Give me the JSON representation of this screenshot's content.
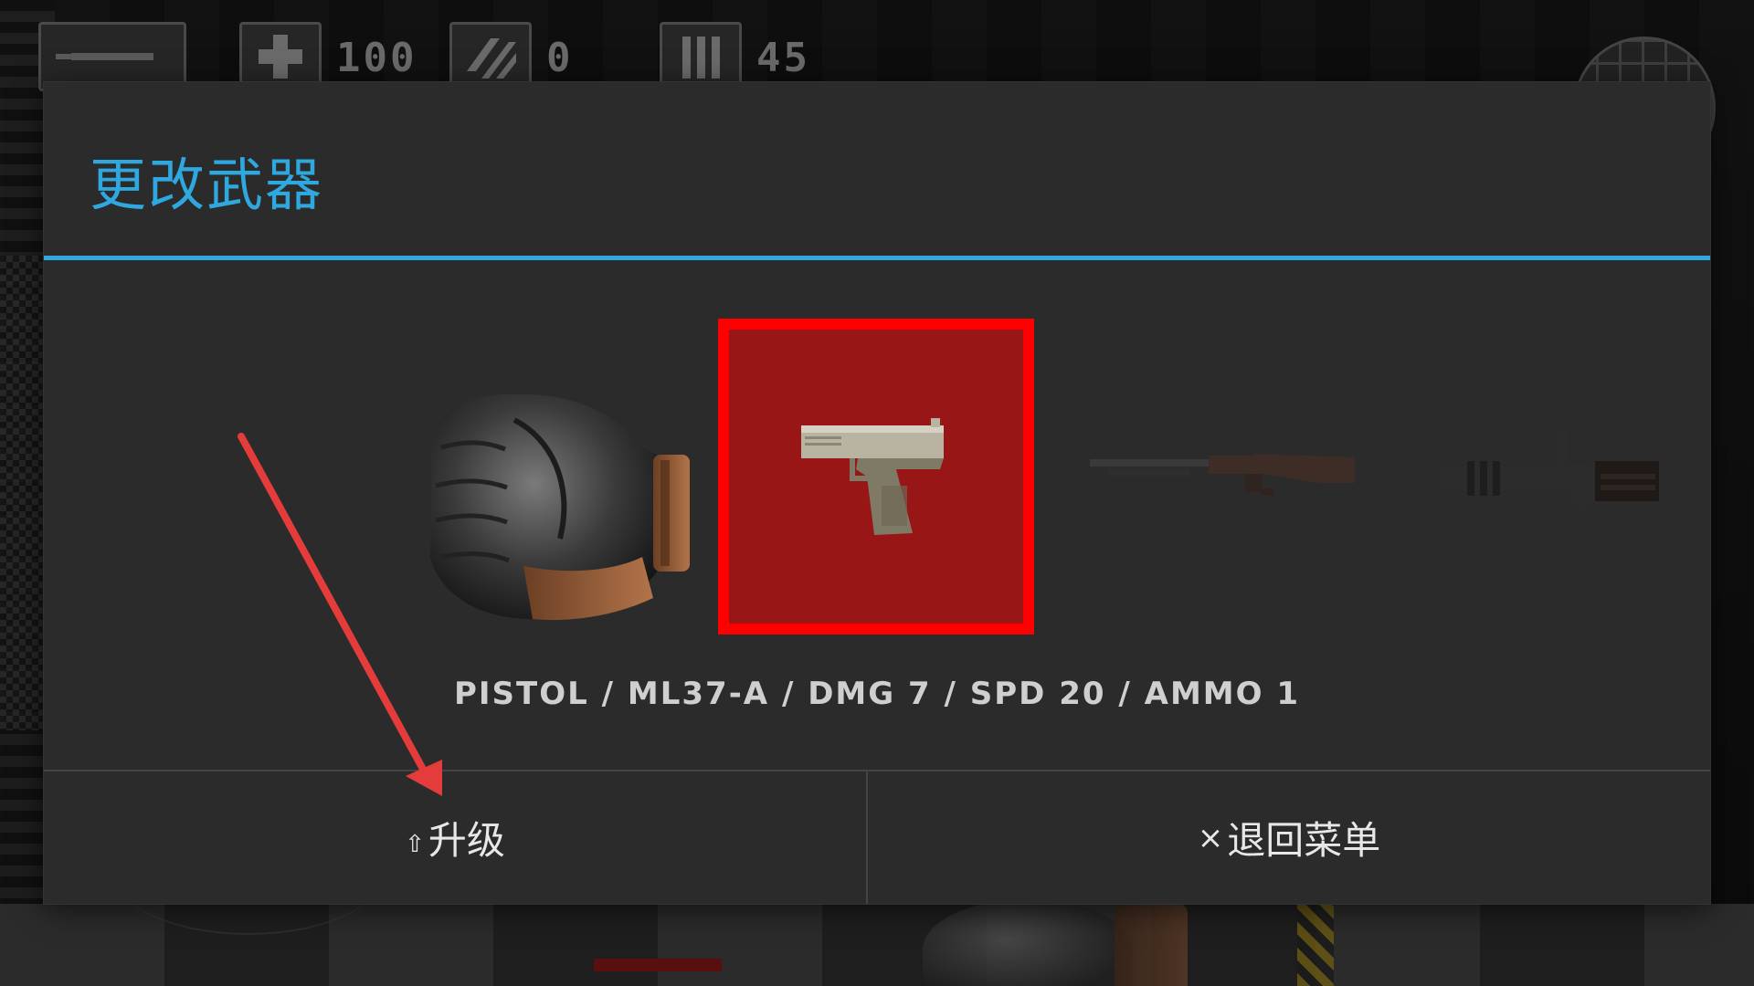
{
  "hud": {
    "health": "100",
    "armor": "0",
    "ammo": "45",
    "icons": [
      "menu-icon",
      "health-cross-icon",
      "armor-stripes-icon",
      "ammo-bullets-icon",
      "minimap-icon"
    ]
  },
  "dialog": {
    "title": "更改武器",
    "weapons": [
      {
        "name": "fist",
        "icon": "fist-icon",
        "selected": false
      },
      {
        "name": "pistol",
        "icon": "pistol-icon",
        "selected": true
      },
      {
        "name": "shotgun",
        "icon": "shotgun-icon",
        "selected": false
      },
      {
        "name": "minigun",
        "icon": "minigun-icon",
        "selected": false
      }
    ],
    "weapon_info": "PISTOL / ML37-A / DMG 7 / SPD 20 / AMMO 1",
    "upgrade_icon": "⇧",
    "upgrade_label": "升级",
    "back_icon": "×",
    "back_label": "退回菜单"
  },
  "colors": {
    "accent": "#2ea8df",
    "selected_border": "#ff0000",
    "selected_fill": "#981616",
    "annotation": "#e43b3b"
  }
}
